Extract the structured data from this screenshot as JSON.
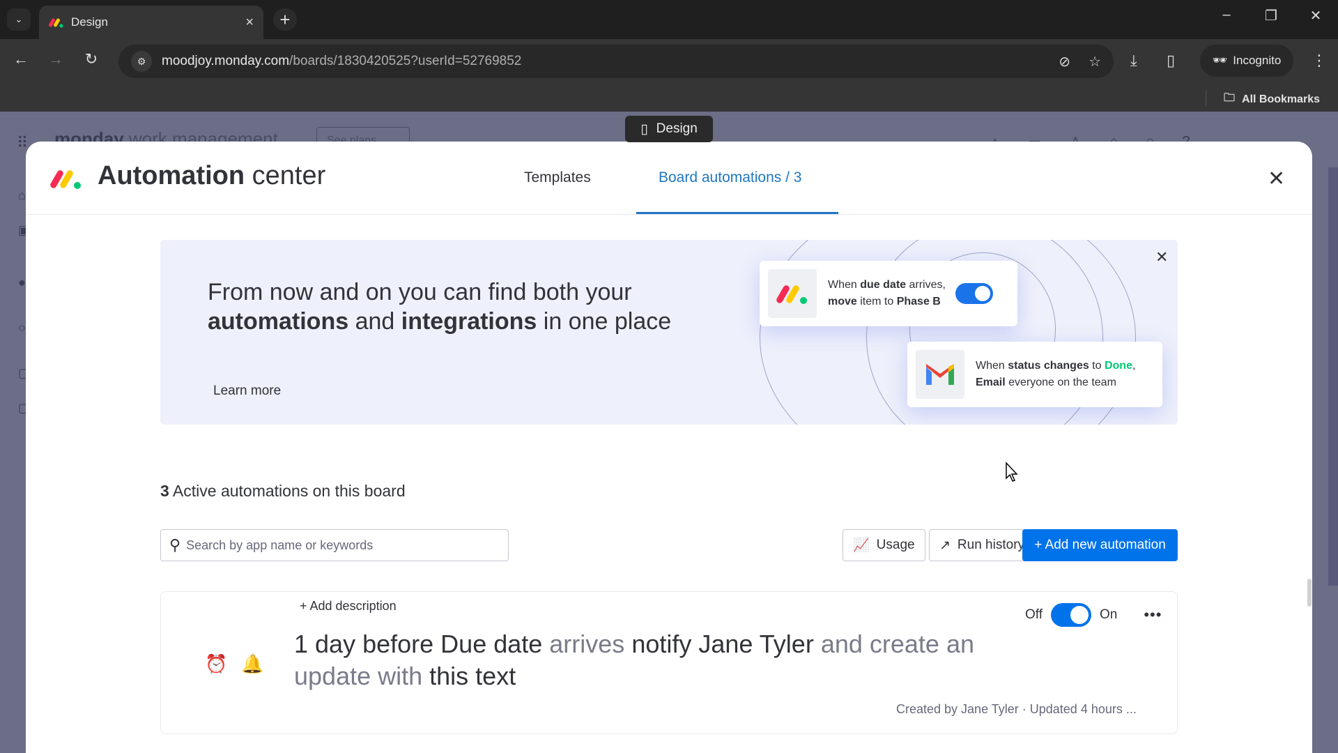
{
  "browser": {
    "tab_title": "Design",
    "tab_close": "×",
    "new_tab": "+",
    "url_host": "moodjoy.monday.com",
    "url_path": "/boards/1830420525?userId=52769852",
    "incognito_label": "Incognito",
    "all_bookmarks_label": "All Bookmarks",
    "window_controls": [
      "–",
      "❐",
      "✕"
    ]
  },
  "background_page": {
    "brand_bold": "monday",
    "brand_light": " work management",
    "see_plans_label": "See plans"
  },
  "design_chip": {
    "label": "Design"
  },
  "modal": {
    "title_bold": "Automation",
    "title_light": " center",
    "tabs": [
      {
        "label": "Templates",
        "active": false
      },
      {
        "label": "Board automations / 3",
        "active": true
      }
    ],
    "close": "✕"
  },
  "banner": {
    "line1": "From now and on you can find both your",
    "bold1": "automations",
    "mid": " and ",
    "bold2": "integrations",
    "tail": " in one place",
    "learn_more": "Learn more",
    "close": "✕",
    "card1": {
      "pre": "When ",
      "b1": "due date",
      "mid": " arrives, ",
      "b2": "move",
      "mid2": " item to ",
      "b3": "Phase B",
      "toggle_on": true
    },
    "card2": {
      "pre": "When ",
      "b1": "status changes",
      "mid": " to ",
      "green": "Done",
      "comma": ",",
      "b2": "Email",
      "tail": " everyone on the team"
    }
  },
  "active": {
    "count": "3",
    "label": " Active automations on this board"
  },
  "search": {
    "placeholder": "Search by app name or keywords",
    "value": ""
  },
  "buttons": {
    "usage": "Usage",
    "run_history": "Run history",
    "add_new": "+ Add new automation"
  },
  "automation": {
    "add_description": "+ Add description",
    "parts": [
      {
        "text": "1 day before",
        "bold": true
      },
      {
        "text": " ",
        "bold": false
      },
      {
        "text": "Due date",
        "bold": true
      },
      {
        "text": " arrives ",
        "bold": false
      },
      {
        "text": "notify",
        "bold": true
      },
      {
        "text": " ",
        "bold": false
      },
      {
        "text": "Jane Tyler",
        "bold": true
      },
      {
        "text": " and create an update with ",
        "bold": false
      },
      {
        "text": "this text",
        "bold": true
      }
    ],
    "off_label": "Off",
    "on_label": "On",
    "enabled": true,
    "more": "•••",
    "meta": "Created by Jane Tyler · Updated 4 hours ..."
  },
  "colors": {
    "primary": "#0073ea",
    "tab_active": "#1f76c2",
    "text": "#323338",
    "banner_bg": "#eef0fb",
    "done_green": "#00c875"
  }
}
